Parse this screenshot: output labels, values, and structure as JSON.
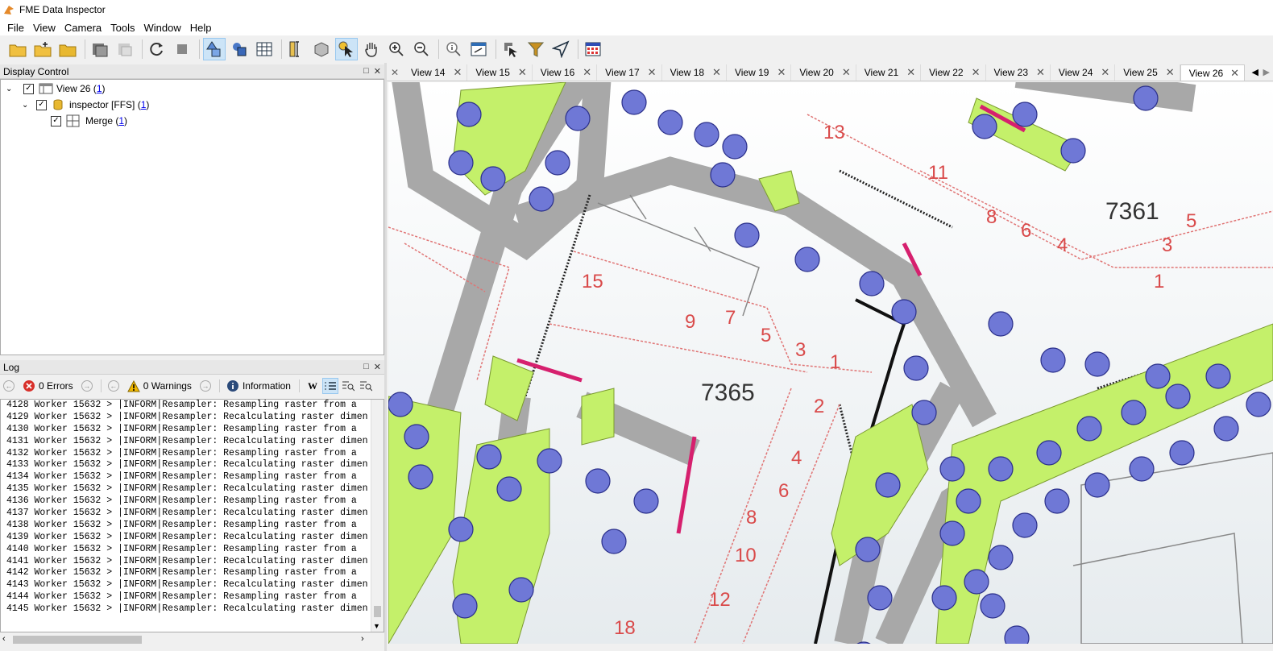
{
  "window": {
    "title": "FME Data Inspector"
  },
  "menu": [
    "File",
    "View",
    "Camera",
    "Tools",
    "Window",
    "Help"
  ],
  "display_control": {
    "title": "Display Control",
    "tree": {
      "view": {
        "label": "View 26 (",
        "count": "1",
        "close": ")"
      },
      "dataset": {
        "label": "inspector [FFS] (",
        "count": "1",
        "close": ")"
      },
      "feature": {
        "label": "Merge (",
        "count": "1",
        "close": ")"
      }
    }
  },
  "log": {
    "title": "Log",
    "errors": "0 Errors",
    "warnings": "0 Warnings",
    "info": "Information",
    "lines": [
      "4128 Worker 15632 > |INFORM|Resampler: Resampling raster from a ",
      "4129 Worker 15632 > |INFORM|Resampler: Recalculating raster dimen",
      "4130 Worker 15632 > |INFORM|Resampler: Resampling raster from a ",
      "4131 Worker 15632 > |INFORM|Resampler: Recalculating raster dimen",
      "4132 Worker 15632 > |INFORM|Resampler: Resampling raster from a ",
      "4133 Worker 15632 > |INFORM|Resampler: Recalculating raster dimen",
      "4134 Worker 15632 > |INFORM|Resampler: Resampling raster from a ",
      "4135 Worker 15632 > |INFORM|Resampler: Recalculating raster dimen",
      "4136 Worker 15632 > |INFORM|Resampler: Resampling raster from a ",
      "4137 Worker 15632 > |INFORM|Resampler: Recalculating raster dimen",
      "4138 Worker 15632 > |INFORM|Resampler: Resampling raster from a ",
      "4139 Worker 15632 > |INFORM|Resampler: Recalculating raster dimen",
      "4140 Worker 15632 > |INFORM|Resampler: Resampling raster from a ",
      "4141 Worker 15632 > |INFORM|Resampler: Recalculating raster dimen",
      "4142 Worker 15632 > |INFORM|Resampler: Resampling raster from a ",
      "4143 Worker 15632 > |INFORM|Resampler: Recalculating raster dimen",
      "4144 Worker 15632 > |INFORM|Resampler: Resampling raster from a ",
      "4145 Worker 15632 > |INFORM|Resampler: Recalculating raster dimen"
    ]
  },
  "tabs": [
    "View 14",
    "View 15",
    "View 16",
    "View 17",
    "View 18",
    "View 19",
    "View 20",
    "View 21",
    "View 22",
    "View 23",
    "View 24",
    "View 25",
    "View 26"
  ],
  "active_tab": "View 26",
  "map": {
    "labels": [
      "7361",
      "7365",
      "13",
      "11",
      "8",
      "6",
      "4",
      "3",
      "1",
      "5",
      "15",
      "9",
      "7",
      "5",
      "3",
      "1",
      "2",
      "4",
      "6",
      "8",
      "10",
      "12",
      "18"
    ]
  },
  "colors": {
    "green": "#c4f06a",
    "road": "#a8a8a8",
    "tree": "#6f78d6",
    "plot_red": "#e07474",
    "magenta": "#d6206e"
  }
}
